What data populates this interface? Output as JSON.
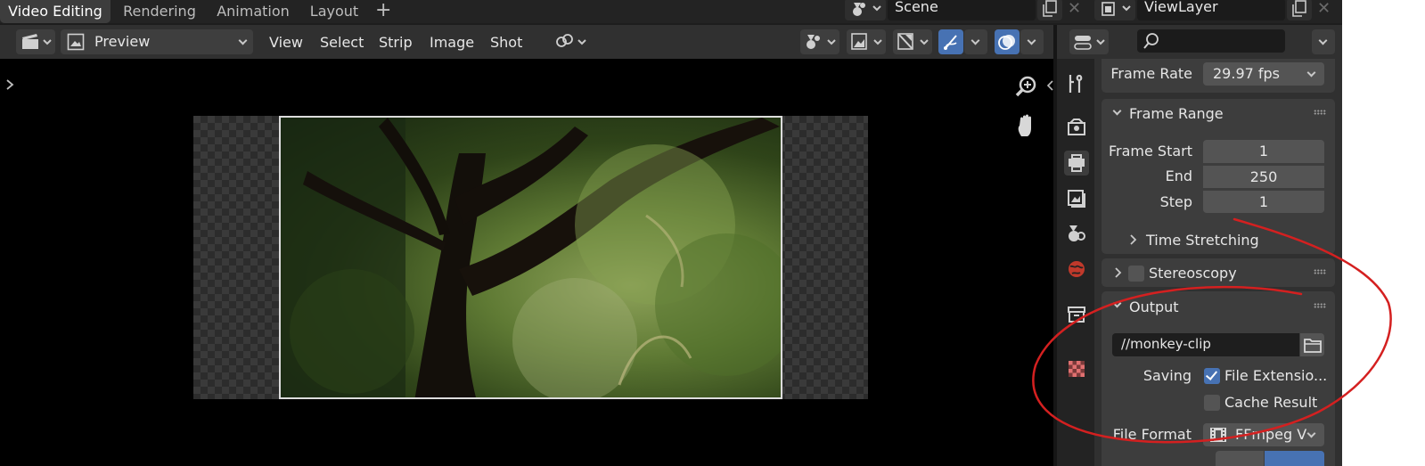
{
  "workspace_tabs": [
    {
      "label": "Video Editing"
    },
    {
      "label": "Rendering"
    },
    {
      "label": "Animation"
    },
    {
      "label": "Layout"
    }
  ],
  "add_workspace": "+",
  "scene": {
    "name": "Scene"
  },
  "view_layer": {
    "name": "ViewLayer"
  },
  "close_glyph": "✕",
  "sequencer": {
    "mode": "Preview",
    "menus": [
      "View",
      "Select",
      "Strip",
      "Image",
      "Shot"
    ]
  },
  "properties": {
    "search_placeholder": "",
    "frame_rate": {
      "label": "Frame Rate",
      "value": "29.97 fps"
    },
    "frame_range": {
      "title": "Frame Range",
      "start_label": "Frame Start",
      "start": "1",
      "end_label": "End",
      "end": "250",
      "step_label": "Step",
      "step": "1"
    },
    "time_stretching": "Time Stretching",
    "stereoscopy": "Stereoscopy",
    "output": {
      "title": "Output",
      "path": "//monkey-clip",
      "saving_label": "Saving",
      "file_extensions": "File Extensio...",
      "file_extensions_checked": true,
      "cache_result": "Cache Result",
      "cache_result_checked": false,
      "file_format_label": "File Format",
      "file_format": "FFmpeg V"
    }
  },
  "annotation": {
    "color": "#d42020"
  },
  "colors": {
    "accent": "#4772b3",
    "editor_bg": "#303030"
  }
}
